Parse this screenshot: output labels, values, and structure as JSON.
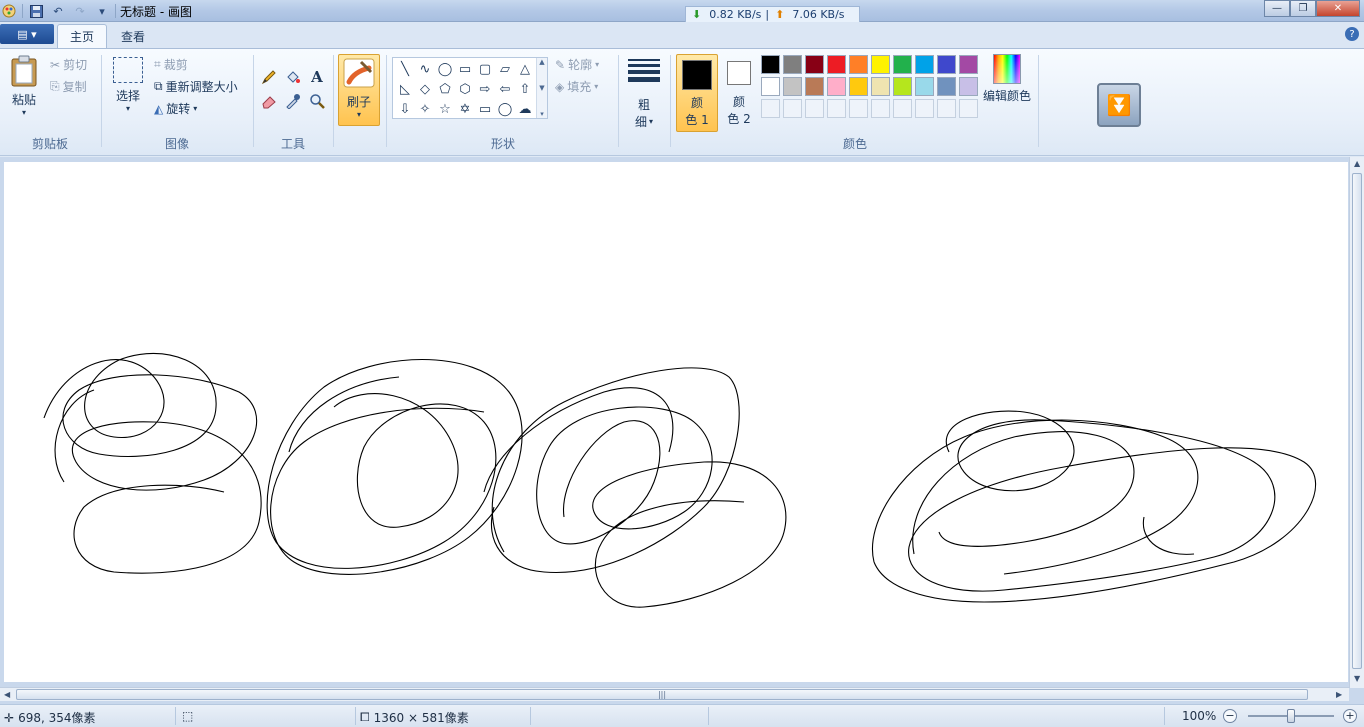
{
  "titlebar": {
    "title": "无标题 - 画图",
    "net_down": "0.82 KB/s",
    "net_up": "7.06 KB/s",
    "minimize": "—",
    "maximize": "❐",
    "close": "✕"
  },
  "tabs": {
    "menu_glyph": "▤ ▾",
    "home": "主页",
    "view": "查看",
    "help": "?"
  },
  "ribbon": {
    "clipboard": {
      "label": "剪贴板",
      "paste": "粘贴",
      "cut": "剪切",
      "copy": "复制"
    },
    "image": {
      "label": "图像",
      "select": "选择",
      "crop": "裁剪",
      "resize": "重新调整大小",
      "rotate": "旋转"
    },
    "tools": {
      "label": "工具"
    },
    "brushes": {
      "label": "刷子"
    },
    "shapes": {
      "label": "形状",
      "outline": "轮廓",
      "fill": "填充",
      "items": [
        "╲",
        "∿",
        "◯",
        "▭",
        "▢",
        "▱",
        "△",
        "◺",
        "◇",
        "⬠",
        "⬡",
        "⇨",
        "⇦",
        "⇧",
        "⇩",
        "✧",
        "☆",
        "✡",
        "▭",
        "◯",
        "☁"
      ]
    },
    "size": {
      "label_line1": "粗",
      "label_line2": "细"
    },
    "colors": {
      "label": "颜色",
      "color1_line1": "颜",
      "color1_line2": "色 1",
      "color2_line1": "颜",
      "color2_line2": "色 2",
      "color1_value": "#000000",
      "color2_value": "#ffffff",
      "edit": "编辑颜色",
      "palette": [
        "#000000",
        "#7f7f7f",
        "#880015",
        "#ed1c24",
        "#ff7f27",
        "#fff200",
        "#22b14c",
        "#00a2e8",
        "#3f48cc",
        "#a349a4",
        "#ffffff",
        "#c3c3c3",
        "#b97a57",
        "#ffaec9",
        "#ffc90e",
        "#efe4b0",
        "#b5e61d",
        "#99d9ea",
        "#7092be",
        "#c8bfe7"
      ]
    }
  },
  "status": {
    "cursor_pos": "698, 354像素",
    "canvas_size": "1360 × 581像素",
    "zoom": "100%",
    "zoom_out": "−",
    "zoom_in": "+"
  }
}
